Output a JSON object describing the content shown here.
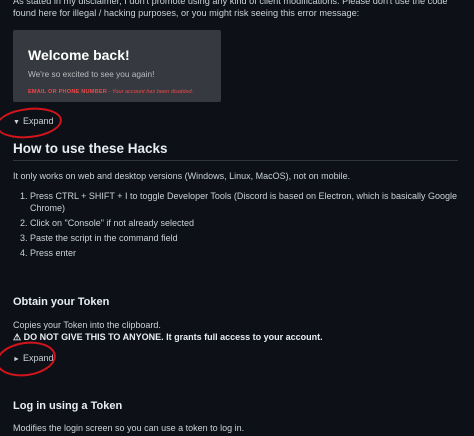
{
  "intro_text": "As stated in my disclaimer, I don't promote using any kind of client modifications. Please don't use the code found here for illegal / hacking purposes, or you might risk seeing this error message:",
  "discord": {
    "title": "Welcome back!",
    "subtitle": "We're so excited to see you again!",
    "error_label": "EMAIL OR PHONE NUMBER",
    "error_separator": " - ",
    "error_message": "Your account has been disabled."
  },
  "expand_label": "Expand",
  "how_to": {
    "heading": "How to use these Hacks",
    "note": "It only works on web and desktop versions (Windows, Linux, MacOS), not on mobile.",
    "steps": [
      "Press CTRL + SHIFT + I to toggle Developer Tools (Discord is based on Electron, which is basically Google Chrome)",
      "Click on \"Console\" if not already selected",
      "Paste the script in the command field",
      "Press enter"
    ]
  },
  "token": {
    "heading": "Obtain your Token",
    "description": "Copies your Token into the clipboard.",
    "warning": "⚠ DO NOT GIVE THIS TO ANYONE. It grants full access to your account."
  },
  "login": {
    "heading": "Log in using a Token",
    "description": "Modifies the login screen so you can use a token to log in."
  },
  "colors": {
    "background": "#0d1117",
    "text": "#c9d1d9",
    "annotation_circle": "#d3141b",
    "discord_card": "#36393f",
    "discord_error": "#f04747"
  }
}
